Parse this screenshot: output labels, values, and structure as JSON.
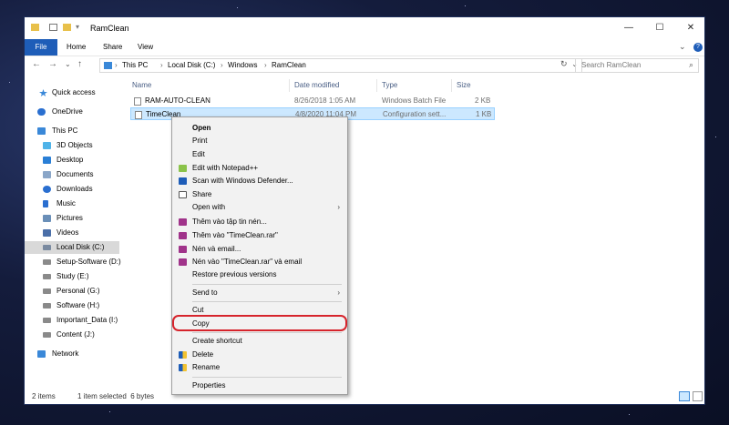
{
  "window": {
    "title": "RamClean",
    "controls": [
      "—",
      "☐",
      "✕"
    ]
  },
  "ribbon": {
    "tabs": [
      "File",
      "Home",
      "Share",
      "View"
    ]
  },
  "address": {
    "crumbs": [
      "This PC",
      "Local Disk (C:)",
      "Windows",
      "RamClean"
    ],
    "search_placeholder": "Search RamClean"
  },
  "sidebar": {
    "items": [
      {
        "label": "Quick access",
        "icon": "star-icon"
      },
      {
        "label": "OneDrive",
        "icon": "cloud-icon"
      },
      {
        "label": "This PC",
        "icon": "computer-icon"
      },
      {
        "label": "3D Objects",
        "icon": "cube-icon"
      },
      {
        "label": "Desktop",
        "icon": "desktop-icon"
      },
      {
        "label": "Documents",
        "icon": "documents-icon"
      },
      {
        "label": "Downloads",
        "icon": "download-icon"
      },
      {
        "label": "Music",
        "icon": "music-icon"
      },
      {
        "label": "Pictures",
        "icon": "pictures-icon"
      },
      {
        "label": "Videos",
        "icon": "videos-icon"
      },
      {
        "label": "Local Disk (C:)",
        "icon": "drive-icon"
      },
      {
        "label": "Setup-Software (D:)",
        "icon": "drive-icon"
      },
      {
        "label": "Study (E:)",
        "icon": "drive-icon"
      },
      {
        "label": "Personal (G:)",
        "icon": "drive-icon"
      },
      {
        "label": "Software (H:)",
        "icon": "drive-icon"
      },
      {
        "label": "Important_Data (I:)",
        "icon": "drive-icon"
      },
      {
        "label": "Content (J:)",
        "icon": "drive-icon"
      },
      {
        "label": "Network",
        "icon": "network-icon"
      }
    ]
  },
  "files": {
    "headers": [
      "Name",
      "Date modified",
      "Type",
      "Size"
    ],
    "rows": [
      {
        "name": "RAM-AUTO-CLEAN",
        "date": "8/26/2018 1:05 AM",
        "type": "Windows Batch File",
        "size": "2 KB"
      },
      {
        "name": "TimeClean",
        "date": "4/8/2020 11:04 PM",
        "type": "Configuration sett...",
        "size": "1 KB"
      }
    ]
  },
  "context_menu": {
    "items": [
      {
        "label": "Open",
        "bold": true
      },
      {
        "label": "Print"
      },
      {
        "label": "Edit"
      },
      {
        "label": "Edit with Notepad++",
        "icon": "notepad-icon"
      },
      {
        "label": "Scan with Windows Defender...",
        "icon": "defender-icon"
      },
      {
        "label": "Share",
        "icon": "share-icon"
      },
      {
        "label": "Open with",
        "submenu": true
      },
      {
        "label": "Thêm vào tập tin nén...",
        "icon": "winrar-icon"
      },
      {
        "label": "Thêm vào \"TimeClean.rar\"",
        "icon": "winrar-icon"
      },
      {
        "label": "Nén và email...",
        "icon": "winrar-icon"
      },
      {
        "label": "Nén vào \"TimeClean.rar\" và email",
        "icon": "winrar-icon"
      },
      {
        "label": "Restore previous versions"
      },
      {
        "label": "Send to",
        "submenu": true
      },
      {
        "label": "Cut"
      },
      {
        "label": "Copy"
      },
      {
        "label": "Create shortcut"
      },
      {
        "label": "Delete",
        "icon": "shield-icon"
      },
      {
        "label": "Rename",
        "icon": "shield-icon"
      },
      {
        "label": "Properties"
      }
    ]
  },
  "status": {
    "count": "2 items",
    "selection": "1 item selected  6 bytes"
  },
  "colors": {
    "accent": "#1e5db8",
    "selection": "#cce8ff",
    "highlight_ring": "#d6242c"
  }
}
